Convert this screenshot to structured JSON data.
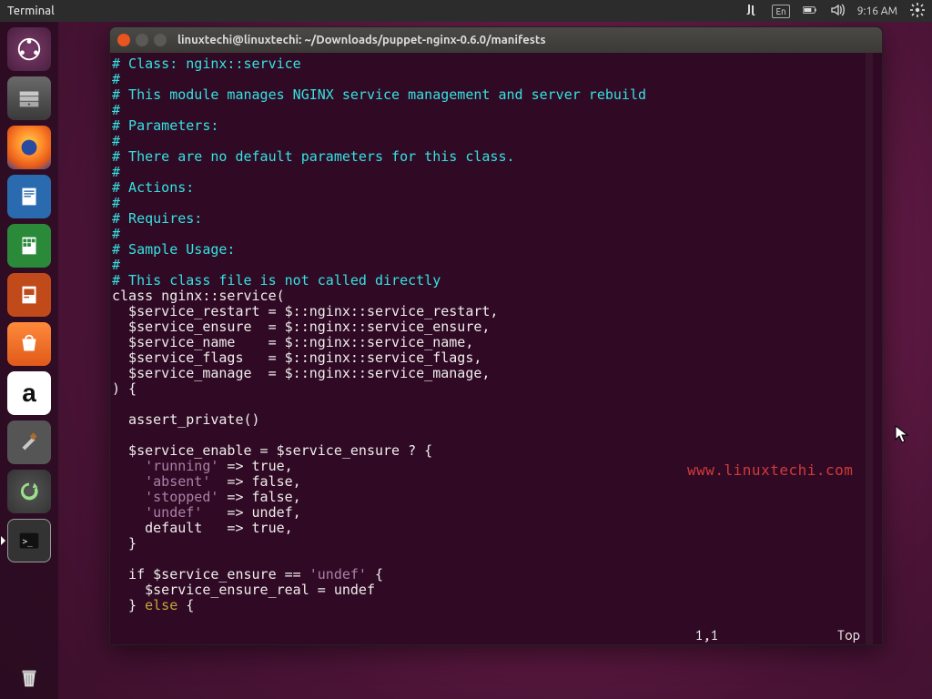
{
  "top_panel": {
    "title": "Terminal",
    "lang": "En",
    "time": "9:16 AM"
  },
  "launcher": {
    "items": [
      {
        "name": "dash",
        "tip": "Dash"
      },
      {
        "name": "files",
        "tip": "Files"
      },
      {
        "name": "firefox",
        "tip": "Firefox"
      },
      {
        "name": "writer",
        "tip": "LibreOffice Writer"
      },
      {
        "name": "calc",
        "tip": "LibreOffice Calc"
      },
      {
        "name": "impress",
        "tip": "LibreOffice Impress"
      },
      {
        "name": "software",
        "tip": "Ubuntu Software"
      },
      {
        "name": "amazon",
        "tip": "Amazon"
      },
      {
        "name": "settings",
        "tip": "System Settings"
      },
      {
        "name": "updater",
        "tip": "Software Updater"
      },
      {
        "name": "terminal",
        "tip": "Terminal"
      }
    ],
    "trash": "Trash"
  },
  "terminal": {
    "window_title": "linuxtechi@linuxtechi: ~/Downloads/puppet-nginx-0.6.0/manifests",
    "status_position": "1,1",
    "status_percent": "Top",
    "code_lines": [
      {
        "t": "# Class: nginx::service",
        "c": "comment"
      },
      {
        "t": "#",
        "c": "comment"
      },
      {
        "t": "# This module manages NGINX service management and server rebuild",
        "c": "comment"
      },
      {
        "t": "#",
        "c": "comment"
      },
      {
        "t": "# Parameters:",
        "c": "comment"
      },
      {
        "t": "#",
        "c": "comment"
      },
      {
        "t": "# There are no default parameters for this class.",
        "c": "comment"
      },
      {
        "t": "#",
        "c": "comment"
      },
      {
        "t": "# Actions:",
        "c": "comment"
      },
      {
        "t": "#",
        "c": "comment"
      },
      {
        "t": "# Requires:",
        "c": "comment"
      },
      {
        "t": "#",
        "c": "comment"
      },
      {
        "t": "# Sample Usage:",
        "c": "comment"
      },
      {
        "t": "#",
        "c": "comment"
      },
      {
        "t": "# This class file is not called directly",
        "c": "comment"
      },
      {
        "t": "class nginx::service(",
        "c": "default"
      },
      {
        "t": "  $service_restart = $::nginx::service_restart,",
        "c": "default"
      },
      {
        "t": "  $service_ensure  = $::nginx::service_ensure,",
        "c": "default"
      },
      {
        "t": "  $service_name    = $::nginx::service_name,",
        "c": "default"
      },
      {
        "t": "  $service_flags   = $::nginx::service_flags,",
        "c": "default"
      },
      {
        "t": "  $service_manage  = $::nginx::service_manage,",
        "c": "default"
      },
      {
        "t": ") {",
        "c": "default"
      },
      {
        "t": "",
        "c": "default"
      },
      {
        "t": "  assert_private()",
        "c": "default"
      },
      {
        "t": "",
        "c": "default"
      },
      {
        "t": "  $service_enable = $service_ensure ? {",
        "c": "default"
      },
      {
        "spans": [
          {
            "t": "    ",
            "c": "default"
          },
          {
            "t": "'running'",
            "c": "string"
          },
          {
            "t": " => true,",
            "c": "default"
          }
        ]
      },
      {
        "spans": [
          {
            "t": "    ",
            "c": "default"
          },
          {
            "t": "'absent'",
            "c": "string"
          },
          {
            "t": "  => false,",
            "c": "default"
          }
        ]
      },
      {
        "spans": [
          {
            "t": "    ",
            "c": "default"
          },
          {
            "t": "'stopped'",
            "c": "string"
          },
          {
            "t": " => false,",
            "c": "default"
          }
        ]
      },
      {
        "spans": [
          {
            "t": "    ",
            "c": "default"
          },
          {
            "t": "'undef'",
            "c": "string"
          },
          {
            "t": "   => undef,",
            "c": "default"
          }
        ]
      },
      {
        "t": "    default   => true,",
        "c": "default"
      },
      {
        "t": "  }",
        "c": "default"
      },
      {
        "t": "",
        "c": "default"
      },
      {
        "spans": [
          {
            "t": "  if $service_ensure == ",
            "c": "default"
          },
          {
            "t": "'undef'",
            "c": "string"
          },
          {
            "t": " {",
            "c": "default"
          }
        ]
      },
      {
        "t": "    $service_ensure_real = undef",
        "c": "default"
      },
      {
        "spans": [
          {
            "t": "  } ",
            "c": "default"
          },
          {
            "t": "else",
            "c": "keyword"
          },
          {
            "t": " {",
            "c": "default"
          }
        ]
      }
    ]
  },
  "watermark": "www.linuxtechi.com"
}
